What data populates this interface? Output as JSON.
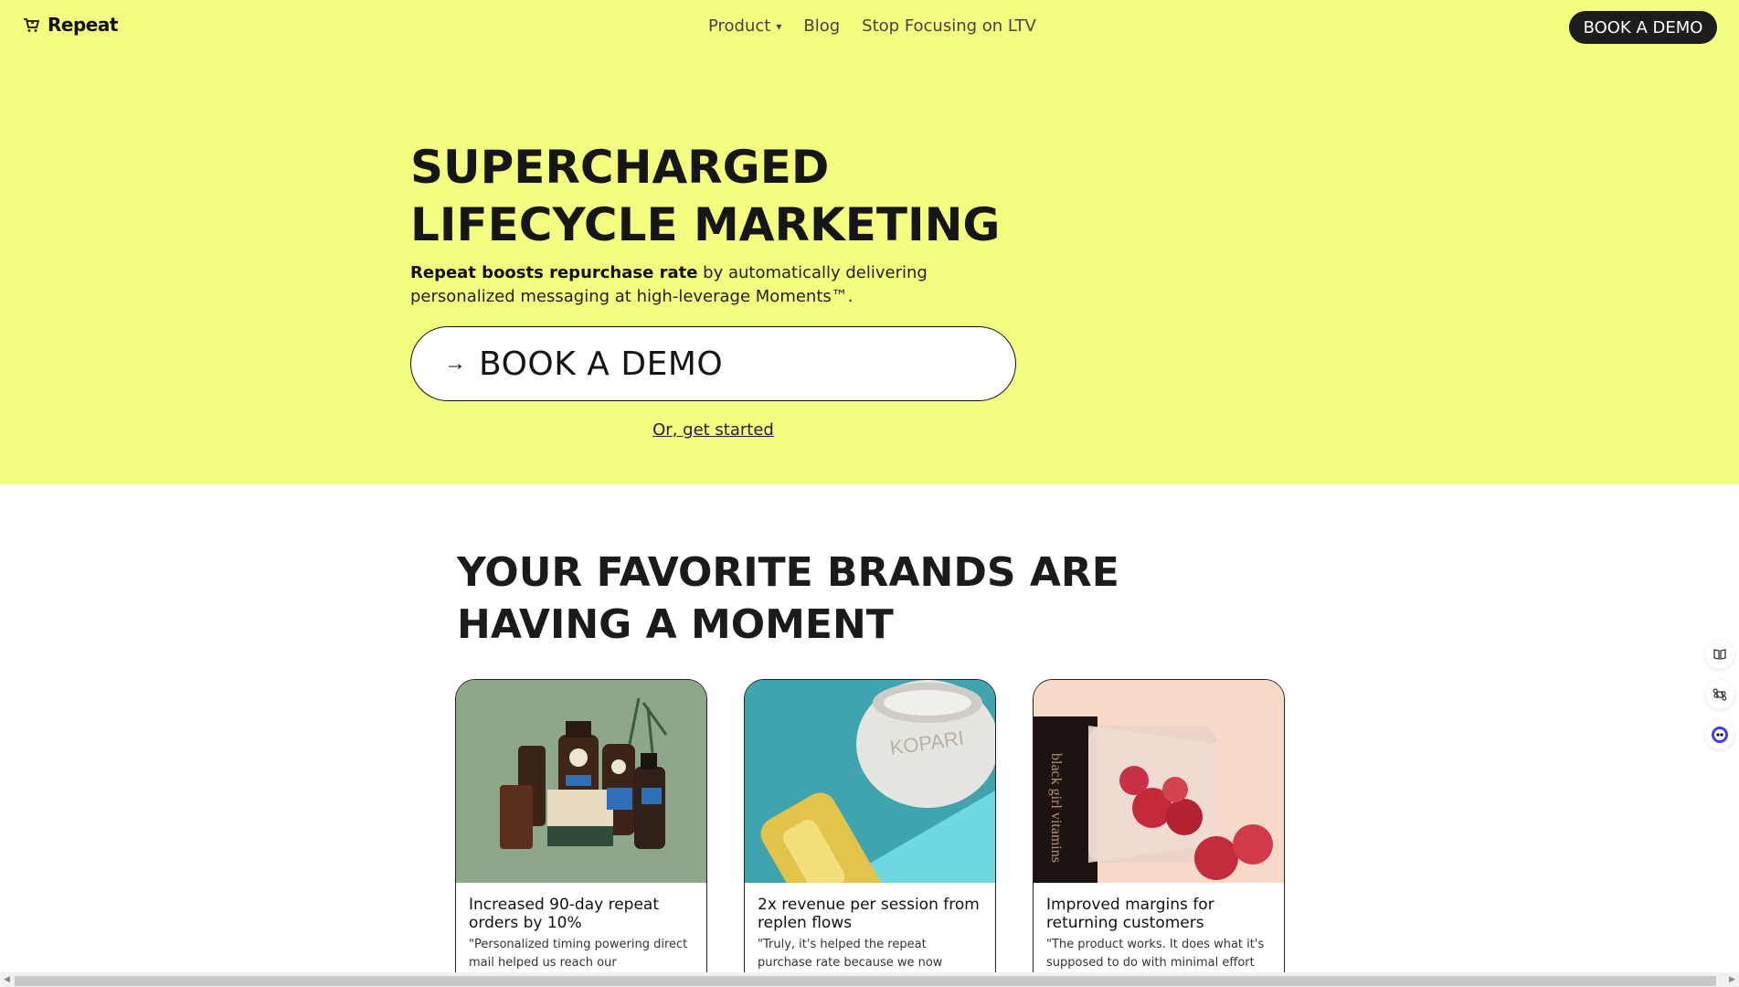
{
  "nav": {
    "logo_text": "Repeat",
    "links": [
      {
        "label": "Product",
        "has_caret": true
      },
      {
        "label": "Blog"
      },
      {
        "label": "Stop Focusing on LTV"
      }
    ],
    "caret": "▾",
    "cta_label": "BOOK A DEMO"
  },
  "hero": {
    "title_line1": "SUPERCHARGED",
    "title_line2": "LIFECYCLE MARKETING",
    "subtitle_bold": "Repeat boosts repurchase rate",
    "subtitle_rest": " by automatically delivering personalized messaging at high-leverage Moments™.",
    "cta_arrow": "→",
    "cta_label": "BOOK A DEMO",
    "alt_link": "Or, get started",
    "bg_color": "#f3fd7f"
  },
  "brands": {
    "title_line1": "YOUR FAVORITE BRANDS ARE",
    "title_line2": "HAVING A MOMENT",
    "cards": [
      {
        "stat": "Increased 90-day repeat orders by 10%",
        "quote": "\"Personalized timing powering direct mail helped us reach our",
        "image": "dr-squatch-products",
        "bg": "#8aa387"
      },
      {
        "stat": "2x revenue per session from replen flows",
        "quote": "\"Truly, it's helped the repeat purchase rate because we now",
        "image": "kopari-body-butter",
        "bg": "#3a9ea6"
      },
      {
        "stat": "Improved margins for returning customers",
        "quote": "\"The product works. It does what it's supposed to do with minimal effort",
        "image": "black-girl-vitamins-gummies",
        "bg": "#f6d8c9"
      }
    ]
  },
  "dock": {
    "icons": [
      "book-icon",
      "command-icon",
      "assistant-face-icon"
    ]
  }
}
